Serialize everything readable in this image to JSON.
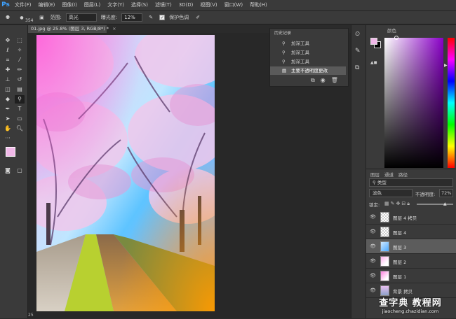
{
  "app": {
    "logo": "Ps"
  },
  "menu": {
    "items": [
      "文件(F)",
      "编辑(E)",
      "图像(I)",
      "图层(L)",
      "文字(Y)",
      "选择(S)",
      "滤镜(T)",
      "3D(D)",
      "视图(V)",
      "窗口(W)",
      "帮助(H)"
    ]
  },
  "options": {
    "brush_size": "354",
    "range_label": "范围:",
    "range_value": "高光",
    "exposure_label": "曝光度:",
    "exposure_value": "12%",
    "protect_tones_label": "保护色调"
  },
  "document": {
    "tab_title": "01.jpg @ 25.8% (图层 3, RGB/8*) *",
    "close": "×",
    "zoom_status": "25"
  },
  "history": {
    "title": "历史记录",
    "items": [
      "加深工具",
      "加深工具",
      "加深工具",
      "主要不透明度更改"
    ],
    "selected_index": 3
  },
  "color_panel": {
    "title": "颜色"
  },
  "layers": {
    "tabs": [
      "图层",
      "通道",
      "路径"
    ],
    "filter_label": "类型",
    "blend_mode": "滤色",
    "opacity_label": "不透明度:",
    "opacity_value": "72%",
    "lock_label": "锁定:",
    "rows": [
      {
        "name": "图层 4 拷贝",
        "thumb": "checker"
      },
      {
        "name": "图层 4",
        "thumb": "checker"
      },
      {
        "name": "图层 3",
        "thumb": "blue"
      },
      {
        "name": "图层 2",
        "thumb": "pink"
      },
      {
        "name": "图层 1",
        "thumb": "pink"
      },
      {
        "name": "背景 拷贝",
        "thumb": "photo"
      }
    ],
    "selected_index": 2
  },
  "watermark": {
    "line1": "查字典 教程网",
    "line2": "jiaocheng.chazidian.com"
  },
  "colors": {
    "foreground": "#f0b8e8",
    "background": "#000000",
    "hue_cursor": "#8a00c8"
  }
}
